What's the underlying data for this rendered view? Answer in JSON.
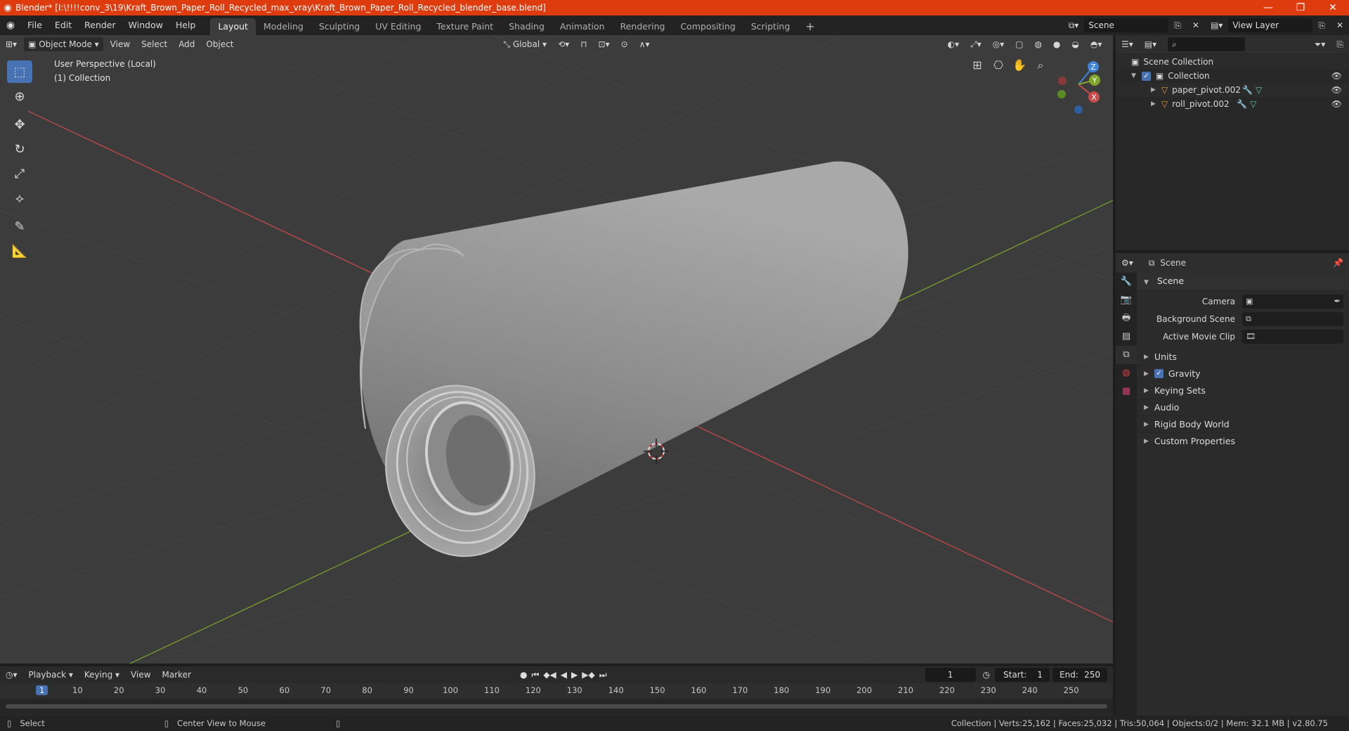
{
  "window": {
    "title": "Blender* [I:\\!!!!conv_3\\19\\Kraft_Brown_Paper_Roll_Recycled_max_vray\\Kraft_Brown_Paper_Roll_Recycled_blender_base.blend]",
    "minimize": "—",
    "maximize": "❐",
    "close": "✕"
  },
  "menu": {
    "items": [
      "File",
      "Edit",
      "Render",
      "Window",
      "Help"
    ],
    "workspaces": [
      "Layout",
      "Modeling",
      "Sculpting",
      "UV Editing",
      "Texture Paint",
      "Shading",
      "Animation",
      "Rendering",
      "Compositing",
      "Scripting"
    ],
    "active_workspace": "Layout",
    "add_tab": "+",
    "scene": "Scene",
    "view_layer": "View Layer"
  },
  "viewport": {
    "mode": "Object Mode",
    "menus": [
      "View",
      "Select",
      "Add",
      "Object"
    ],
    "transform": "Global",
    "perspective": "User Perspective (Local)",
    "collection": "(1) Collection",
    "axes": {
      "x": "X",
      "y": "Y",
      "z": "Z"
    }
  },
  "outliner": {
    "root": "Scene Collection",
    "collection": "Collection",
    "objects": [
      "paper_pivot.002",
      "roll_pivot.002"
    ]
  },
  "properties": {
    "context": "Scene",
    "panel": "Scene",
    "fields": [
      {
        "label": "Camera"
      },
      {
        "label": "Background Scene"
      },
      {
        "label": "Active Movie Clip"
      }
    ],
    "subpanels": [
      "Units",
      "Gravity",
      "Keying Sets",
      "Audio",
      "Rigid Body World",
      "Custom Properties"
    ]
  },
  "timeline": {
    "menus": [
      "Playback",
      "Keying",
      "View",
      "Marker"
    ],
    "current_frame": "1",
    "start_label": "Start:",
    "start": "1",
    "end_label": "End:",
    "end": "250",
    "ticks": [
      "1",
      "10",
      "20",
      "30",
      "40",
      "50",
      "60",
      "70",
      "80",
      "90",
      "100",
      "110",
      "120",
      "130",
      "140",
      "150",
      "160",
      "170",
      "180",
      "190",
      "200",
      "210",
      "220",
      "230",
      "240",
      "250"
    ]
  },
  "status": {
    "left": "Select",
    "middle": "Center View to Mouse",
    "stats": "Collection | Verts:25,162 | Faces:25,032 | Tris:50,064 | Objects:0/2 | Mem: 32.1 MB | v2.80.75"
  },
  "colors": {
    "titlebar": "#de3b0f",
    "accent": "#4772b3",
    "x_axis": "#c94a4a",
    "y_axis": "#7fa52b",
    "z_axis": "#3f84d8"
  }
}
